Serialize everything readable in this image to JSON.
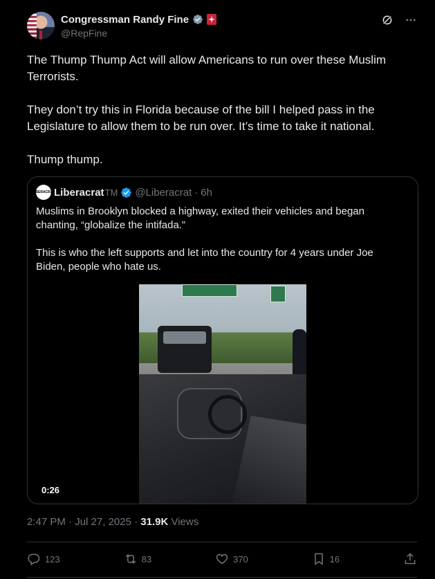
{
  "author": {
    "name": "Congressman Randy Fine",
    "handle": "@RepFine"
  },
  "tweet": {
    "paragraphs": [
      "The Thump Thump Act will allow Americans to run over these Muslim Terrorists.",
      "They don’t try this in Florida because of the bill I helped pass in the Legislature to allow them to be run over.  It’s time to take it national.",
      "Thump thump."
    ]
  },
  "quote": {
    "avatar_text": "LIBERACRAT",
    "name": "Liberacrat",
    "tm": "TM",
    "handle": "@Liberacrat",
    "dot": "·",
    "time": "6h",
    "paragraphs": [
      "Muslims in Brooklyn blocked a highway, exited their vehicles and began chanting, “globalize the intifada.”",
      "This is who the left supports and let into the country for 4 years under Joe Biden, people who hate us."
    ],
    "video_duration": "0:26"
  },
  "meta": {
    "time": "2:47 PM",
    "date": "Jul 27, 2025",
    "sep": " · ",
    "views_count": "31.9K",
    "views_label": " Views"
  },
  "actions": {
    "replies": "123",
    "reposts": "83",
    "likes": "370",
    "bookmarks": "16"
  },
  "colors": {
    "background": "#000000",
    "text": "#e7e9ea",
    "secondary": "#71767b",
    "verified": "#1d9bf0",
    "border": "#2f3336"
  }
}
